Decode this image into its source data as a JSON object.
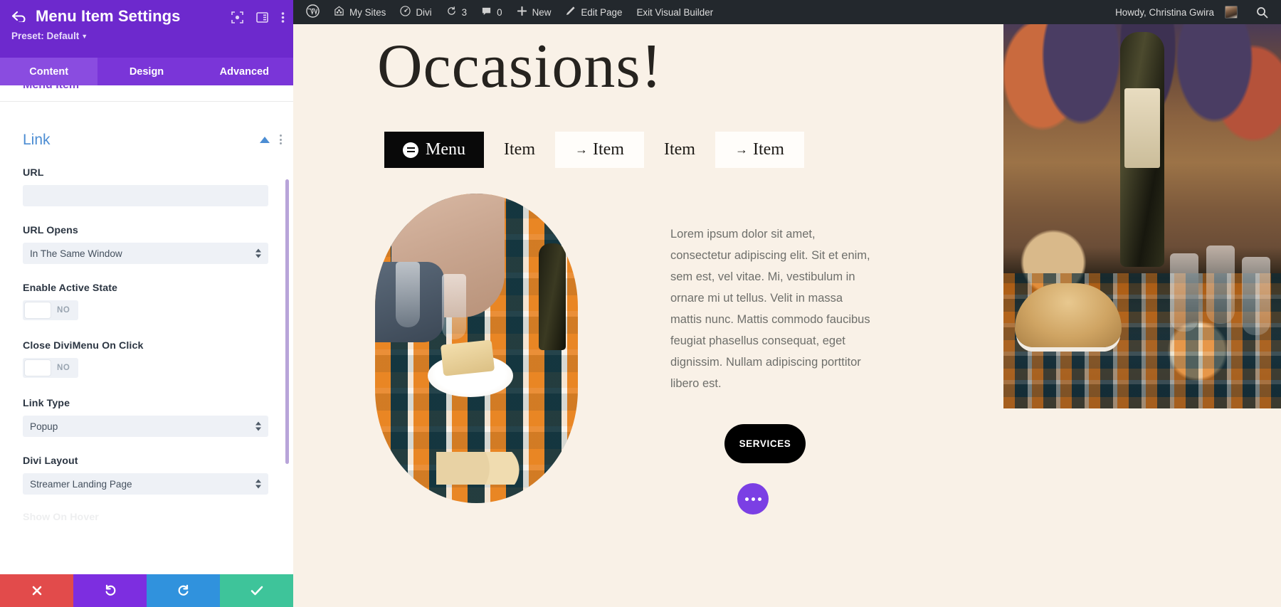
{
  "settings_panel": {
    "title": "Menu Item Settings",
    "back_icon": "back-arrow-icon",
    "preset_label": "Preset: Default",
    "header_icons": [
      "fullscreen-icon",
      "layout-toggle-icon",
      "kebab-menu-icon"
    ],
    "tabs": [
      {
        "label": "Content",
        "active": true
      },
      {
        "label": "Design",
        "active": false
      },
      {
        "label": "Advanced",
        "active": false
      }
    ],
    "cut_off_top_label": "Menu Item",
    "cut_off_bottom_label": "Show On Hover",
    "section": {
      "title": "Link",
      "collapse_icon": "chevron-up-icon",
      "more_icon": "kebab-menu-icon"
    },
    "fields": [
      {
        "label": "URL",
        "type": "text",
        "value": "",
        "placeholder": ""
      },
      {
        "label": "URL Opens",
        "type": "select",
        "value": "In The Same Window"
      },
      {
        "label": "Enable Active State",
        "type": "toggle",
        "value": "NO"
      },
      {
        "label": "Close DiviMenu On Click",
        "type": "toggle",
        "value": "NO"
      },
      {
        "label": "Link Type",
        "type": "select",
        "value": "Popup"
      },
      {
        "label": "Divi Layout",
        "type": "select",
        "value": "Streamer Landing Page"
      }
    ],
    "footer_buttons": [
      {
        "name": "cancel",
        "icon": "close-icon",
        "color": "#e24b4b"
      },
      {
        "name": "undo",
        "icon": "undo-icon",
        "color": "#7d2ee0"
      },
      {
        "name": "redo",
        "icon": "redo-icon",
        "color": "#3092dd"
      },
      {
        "name": "save",
        "icon": "check-icon",
        "color": "#3ec49a"
      }
    ],
    "colors": {
      "header": "#6d29cd",
      "tabs": "#7a35d8",
      "section_title": "#4c8dd3"
    }
  },
  "admin_bar": {
    "logo_icon": "wordpress-logo-icon",
    "items": [
      {
        "label": "My Sites",
        "icon": "sites-icon"
      },
      {
        "label": "Divi",
        "icon": "divi-icon"
      },
      {
        "label": "3",
        "icon": "updates-icon"
      },
      {
        "label": "0",
        "icon": "comments-icon"
      },
      {
        "label": "New",
        "icon": "plus-icon"
      },
      {
        "label": "Edit Page",
        "icon": "pencil-icon"
      },
      {
        "label": "Exit Visual Builder",
        "icon": ""
      }
    ],
    "greeting": "Howdy, Christina Gwira",
    "avatar_name": "avatar",
    "search_icon": "search-icon",
    "background": "#23282d"
  },
  "page": {
    "title": "Occasions!",
    "menu": {
      "toggle_label": "Menu",
      "toggle_icon": "hamburger-circle-icon",
      "items": [
        {
          "label": "Item",
          "arrow": "",
          "card": false
        },
        {
          "label": "Item",
          "arrow": "→",
          "card": true
        },
        {
          "label": "Item",
          "arrow": "",
          "card": false
        },
        {
          "label": "Item",
          "arrow": "→",
          "card": true
        }
      ]
    },
    "body_text": "Lorem ipsum dolor sit amet, consectetur adipiscing elit. Sit et enim, sem est, vel vitae. Mi, vestibulum in ornare mi ut tellus. Velit in massa mattis nunc. Mattis commodo faucibus feugiat phasellus consequat, eget dignissim. Nullam adipiscing porttitor libero est.",
    "cta_label": "SERVICES",
    "dots_button_icon": "ellipsis-icon",
    "colors": {
      "canvas_bg": "#f9f1e7",
      "cta_bg": "#000000",
      "dots_bg": "#7b3fe4"
    }
  }
}
